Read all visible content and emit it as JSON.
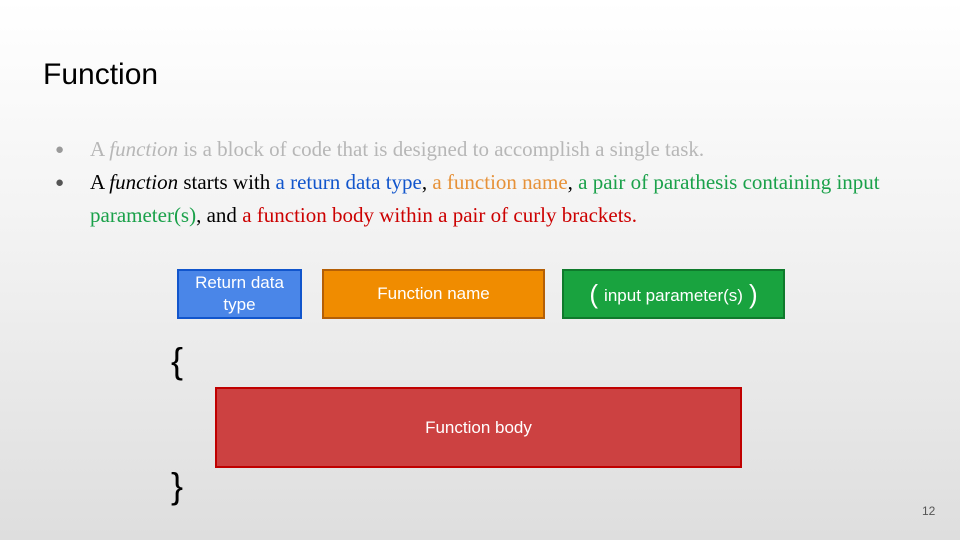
{
  "slide": {
    "title": "Function",
    "page_number": "12"
  },
  "bullets": [
    {
      "dot": "●",
      "parts": [
        "A ",
        "function",
        " is a block of code that is designed to accomplish a single task."
      ]
    },
    {
      "dot": "●",
      "parts": [
        "A ",
        "function",
        " starts with ",
        "a return data type",
        ", ",
        "a function name",
        ", ",
        "a pair of parathesis containing input parameter(s)",
        ", and ",
        "a function body within a pair of curly brackets",
        "."
      ]
    }
  ],
  "diagram": {
    "return_type": "Return data type",
    "function_name": "Function name",
    "param_open": "(",
    "params": "input parameter(s)",
    "param_close": ")",
    "body": "Function body",
    "brace_open": "{",
    "brace_close": "}"
  },
  "colors": {
    "return_type": "#4a86e8",
    "function_name": "#f08c00",
    "params": "#19a33f",
    "body": "#cc4141"
  }
}
